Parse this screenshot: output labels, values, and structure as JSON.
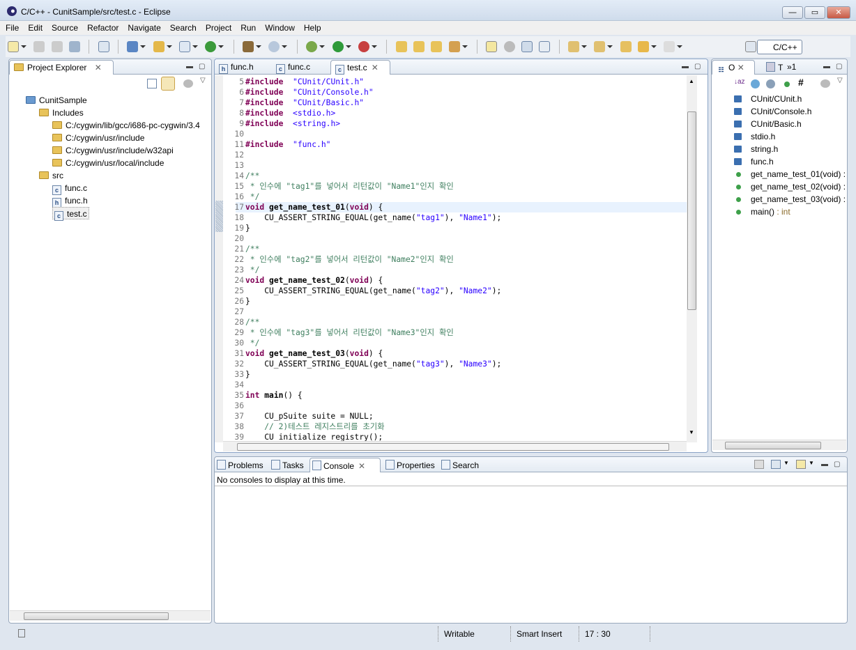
{
  "window": {
    "title": "C/C++ - CunitSample/src/test.c - Eclipse",
    "minimize": "—",
    "maximize": "▭",
    "close": "✕"
  },
  "menu": [
    "File",
    "Edit",
    "Source",
    "Refactor",
    "Navigate",
    "Search",
    "Project",
    "Run",
    "Window",
    "Help"
  ],
  "perspective": {
    "label": "C/C++"
  },
  "project_explorer": {
    "title": "Project Explorer",
    "tree": [
      {
        "label": "CunitSample",
        "icon": "c-project-icon",
        "level": 0
      },
      {
        "label": "Includes",
        "icon": "includes-icon",
        "level": 1
      },
      {
        "label": "C:/cygwin/lib/gcc/i686-pc-cygwin/3.4",
        "icon": "include-folder-icon",
        "level": 2
      },
      {
        "label": "C:/cygwin/usr/include",
        "icon": "include-folder-icon",
        "level": 2
      },
      {
        "label": "C:/cygwin/usr/include/w32api",
        "icon": "include-folder-icon",
        "level": 2
      },
      {
        "label": "C:/cygwin/usr/local/include",
        "icon": "include-folder-icon",
        "level": 2
      },
      {
        "label": "src",
        "icon": "source-folder-icon",
        "level": 1
      },
      {
        "label": "func.c",
        "icon": "c-file-icon",
        "level": 2
      },
      {
        "label": "func.h",
        "icon": "h-file-icon",
        "level": 2
      },
      {
        "label": "test.c",
        "icon": "c-file-icon",
        "level": 2,
        "selected": true
      }
    ]
  },
  "editor": {
    "tabs": [
      {
        "label": "func.h",
        "icon": "h"
      },
      {
        "label": "func.c",
        "icon": "c"
      },
      {
        "label": "test.c",
        "icon": "c",
        "active": true
      }
    ],
    "current_line": 17,
    "lines": [
      {
        "n": "5",
        "t": [
          [
            "kw",
            "#include"
          ],
          [
            "",
            "  "
          ],
          [
            "str",
            "\"CUnit/CUnit.h\""
          ]
        ]
      },
      {
        "n": "6",
        "t": [
          [
            "kw",
            "#include"
          ],
          [
            "",
            "  "
          ],
          [
            "str",
            "\"CUnit/Console.h\""
          ]
        ]
      },
      {
        "n": "7",
        "t": [
          [
            "kw",
            "#include"
          ],
          [
            "",
            "  "
          ],
          [
            "str",
            "\"CUnit/Basic.h\""
          ]
        ]
      },
      {
        "n": "8",
        "t": [
          [
            "kw",
            "#include"
          ],
          [
            "",
            "  "
          ],
          [
            "str",
            "<stdio.h>"
          ]
        ]
      },
      {
        "n": "9",
        "t": [
          [
            "kw",
            "#include"
          ],
          [
            "",
            "  "
          ],
          [
            "str",
            "<string.h>"
          ]
        ]
      },
      {
        "n": "10",
        "t": []
      },
      {
        "n": "11",
        "t": [
          [
            "kw",
            "#include"
          ],
          [
            "",
            "  "
          ],
          [
            "str",
            "\"func.h\""
          ]
        ]
      },
      {
        "n": "12",
        "t": []
      },
      {
        "n": "13",
        "t": []
      },
      {
        "n": "14",
        "t": [
          [
            "cm",
            "/**"
          ]
        ]
      },
      {
        "n": "15",
        "t": [
          [
            "cm",
            " * 인수에 \"tag1\"를 넣어서 리턴값이 \"Name1\"인지 확인"
          ]
        ]
      },
      {
        "n": "16",
        "t": [
          [
            "cm",
            " */"
          ]
        ]
      },
      {
        "n": "17",
        "t": [
          [
            "kw",
            "void"
          ],
          [
            "",
            " "
          ],
          [
            "fn",
            "get_name_test_01"
          ],
          [
            "",
            "("
          ],
          [
            "kw",
            "void"
          ],
          [
            "",
            ") {"
          ]
        ]
      },
      {
        "n": "18",
        "t": [
          [
            "",
            "    CU_ASSERT_STRING_EQUAL(get_name("
          ],
          [
            "str",
            "\"tag1\""
          ],
          [
            "",
            "), "
          ],
          [
            "str",
            "\"Name1\""
          ],
          [
            "",
            ");"
          ]
        ]
      },
      {
        "n": "19",
        "t": [
          [
            "",
            "}"
          ]
        ]
      },
      {
        "n": "20",
        "t": []
      },
      {
        "n": "21",
        "t": [
          [
            "cm",
            "/**"
          ]
        ]
      },
      {
        "n": "22",
        "t": [
          [
            "cm",
            " * 인수에 \"tag2\"를 넣어서 리턴값이 \"Name2\"인지 확인"
          ]
        ]
      },
      {
        "n": "23",
        "t": [
          [
            "cm",
            " */"
          ]
        ]
      },
      {
        "n": "24",
        "t": [
          [
            "kw",
            "void"
          ],
          [
            "",
            " "
          ],
          [
            "fn",
            "get_name_test_02"
          ],
          [
            "",
            "("
          ],
          [
            "kw",
            "void"
          ],
          [
            "",
            ") {"
          ]
        ]
      },
      {
        "n": "25",
        "t": [
          [
            "",
            "    CU_ASSERT_STRING_EQUAL(get_name("
          ],
          [
            "str",
            "\"tag2\""
          ],
          [
            "",
            "), "
          ],
          [
            "str",
            "\"Name2\""
          ],
          [
            "",
            ");"
          ]
        ]
      },
      {
        "n": "26",
        "t": [
          [
            "",
            "}"
          ]
        ]
      },
      {
        "n": "27",
        "t": []
      },
      {
        "n": "28",
        "t": [
          [
            "cm",
            "/**"
          ]
        ]
      },
      {
        "n": "29",
        "t": [
          [
            "cm",
            " * 인수에 \"tag3\"를 넣어서 리턴값이 \"Name3\"인지 확인"
          ]
        ]
      },
      {
        "n": "30",
        "t": [
          [
            "cm",
            " */"
          ]
        ]
      },
      {
        "n": "31",
        "t": [
          [
            "kw",
            "void"
          ],
          [
            "",
            " "
          ],
          [
            "fn",
            "get_name_test_03"
          ],
          [
            "",
            "("
          ],
          [
            "kw",
            "void"
          ],
          [
            "",
            ") {"
          ]
        ]
      },
      {
        "n": "32",
        "t": [
          [
            "",
            "    CU_ASSERT_STRING_EQUAL(get_name("
          ],
          [
            "str",
            "\"tag3\""
          ],
          [
            "",
            "), "
          ],
          [
            "str",
            "\"Name3\""
          ],
          [
            "",
            ");"
          ]
        ]
      },
      {
        "n": "33",
        "t": [
          [
            "",
            "}"
          ]
        ]
      },
      {
        "n": "34",
        "t": []
      },
      {
        "n": "35",
        "t": [
          [
            "kw",
            "int"
          ],
          [
            "",
            " "
          ],
          [
            "fn",
            "main"
          ],
          [
            "",
            "() {"
          ]
        ]
      },
      {
        "n": "36",
        "t": []
      },
      {
        "n": "37",
        "t": [
          [
            "",
            "    CU_pSuite suite = NULL;"
          ]
        ]
      },
      {
        "n": "38",
        "t": [
          [
            "cm",
            "    // 2)테스트 레지스트리를 초기화"
          ]
        ]
      },
      {
        "n": "39",
        "t": [
          [
            "",
            "    CU_initialize_registry();"
          ]
        ]
      }
    ]
  },
  "outline": {
    "tabs": [
      {
        "label": "O"
      },
      {
        "label": "T"
      },
      {
        "label": "»1"
      }
    ],
    "items": [
      {
        "label": "CUnit/CUnit.h",
        "kind": "include"
      },
      {
        "label": "CUnit/Console.h",
        "kind": "include"
      },
      {
        "label": "CUnit/Basic.h",
        "kind": "include"
      },
      {
        "label": "stdio.h",
        "kind": "include"
      },
      {
        "label": "string.h",
        "kind": "include"
      },
      {
        "label": "func.h",
        "kind": "include"
      },
      {
        "label": "get_name_test_01(void) :",
        "kind": "function"
      },
      {
        "label": "get_name_test_02(void) :",
        "kind": "function"
      },
      {
        "label": "get_name_test_03(void) :",
        "kind": "function"
      },
      {
        "label": "main()",
        "kind": "function",
        "type": " : int"
      }
    ]
  },
  "bottom": {
    "tabs": [
      {
        "label": "Problems"
      },
      {
        "label": "Tasks"
      },
      {
        "label": "Console",
        "active": true
      },
      {
        "label": "Properties"
      },
      {
        "label": "Search"
      }
    ],
    "message": "No consoles to display at this time."
  },
  "status": {
    "writable": "Writable",
    "insert_mode": "Smart Insert",
    "position": "17 : 30"
  },
  "colors": {
    "keyword": "#7f0055",
    "string": "#2a00ff",
    "comment": "#3f7f5f",
    "current_line": "#e8f2fe"
  }
}
